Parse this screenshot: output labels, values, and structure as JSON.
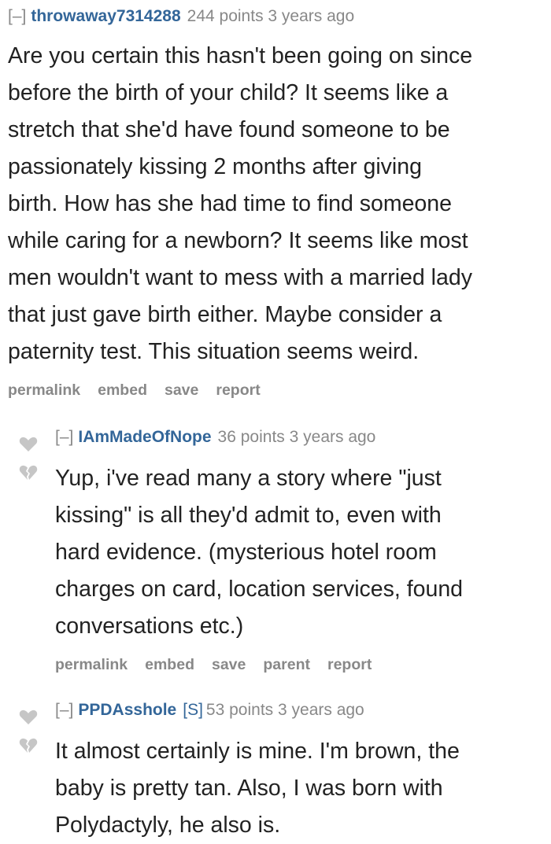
{
  "colors": {
    "author": "#336699",
    "meta": "#888888",
    "body_text": "#222222",
    "vote_arrow": "#c6c6c6"
  },
  "comments": [
    {
      "collapse": "[–]",
      "author": "throwaway7314288",
      "score": "244 points",
      "time": "3 years ago",
      "text": "Are you certain this hasn't been going on since\nbefore the birth of your child? It seems like a\nstretch that she'd have found someone to be\npassionately kissing 2 months after giving\nbirth. How has she had time to find someone\nwhile caring for a newborn? It seems like most\nmen wouldn't want to mess with a married lady\nthat just gave birth either. Maybe consider a\npaternity test. This situation seems weird.",
      "buttons": [
        "permalink",
        "embed",
        "save",
        "report"
      ]
    },
    {
      "collapse": "[–]",
      "author": "IAmMadeOfNope",
      "score": "36 points",
      "time": "3 years ago",
      "text": "Yup, i've read many a story where \"just\nkissing\" is all they'd admit to, even with\nhard evidence. (mysterious hotel room\ncharges on card, location services, found\nconversations etc.)",
      "buttons": [
        "permalink",
        "embed",
        "save",
        "parent",
        "report"
      ]
    },
    {
      "collapse": "[–]",
      "author": "PPDAsshole",
      "submitter_tag": "[S]",
      "score": "53 points",
      "time": "3 years ago",
      "text": "It almost certainly is mine. I'm brown, the\nbaby is pretty tan. Also, I was born with\nPolydactyly, he also is."
    }
  ],
  "icons": {
    "upvote": "upvote-heart-icon",
    "downvote": "downvote-broken-heart-icon"
  }
}
